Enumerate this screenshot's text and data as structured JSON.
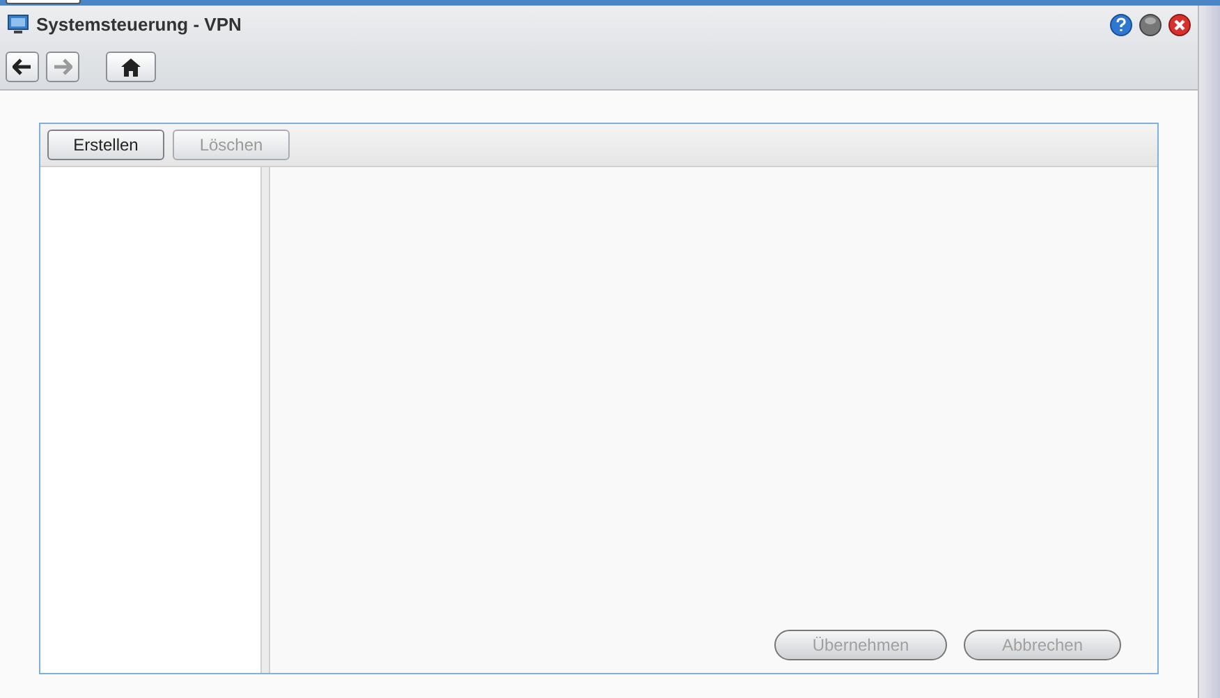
{
  "window": {
    "title": "Systemsteuerung - VPN"
  },
  "nav_buttons": [
    {
      "kind": "back",
      "disabled": false
    },
    {
      "kind": "forward",
      "disabled": true
    },
    {
      "kind": "home",
      "disabled": false
    }
  ],
  "panel_toolbar": [
    {
      "label": "Erstellen",
      "disabled": false
    },
    {
      "label": "Löschen",
      "disabled": true
    }
  ],
  "footer_buttons": [
    {
      "label": "Übernehmen",
      "disabled": true
    },
    {
      "label": "Abbrechen",
      "disabled": true
    }
  ]
}
